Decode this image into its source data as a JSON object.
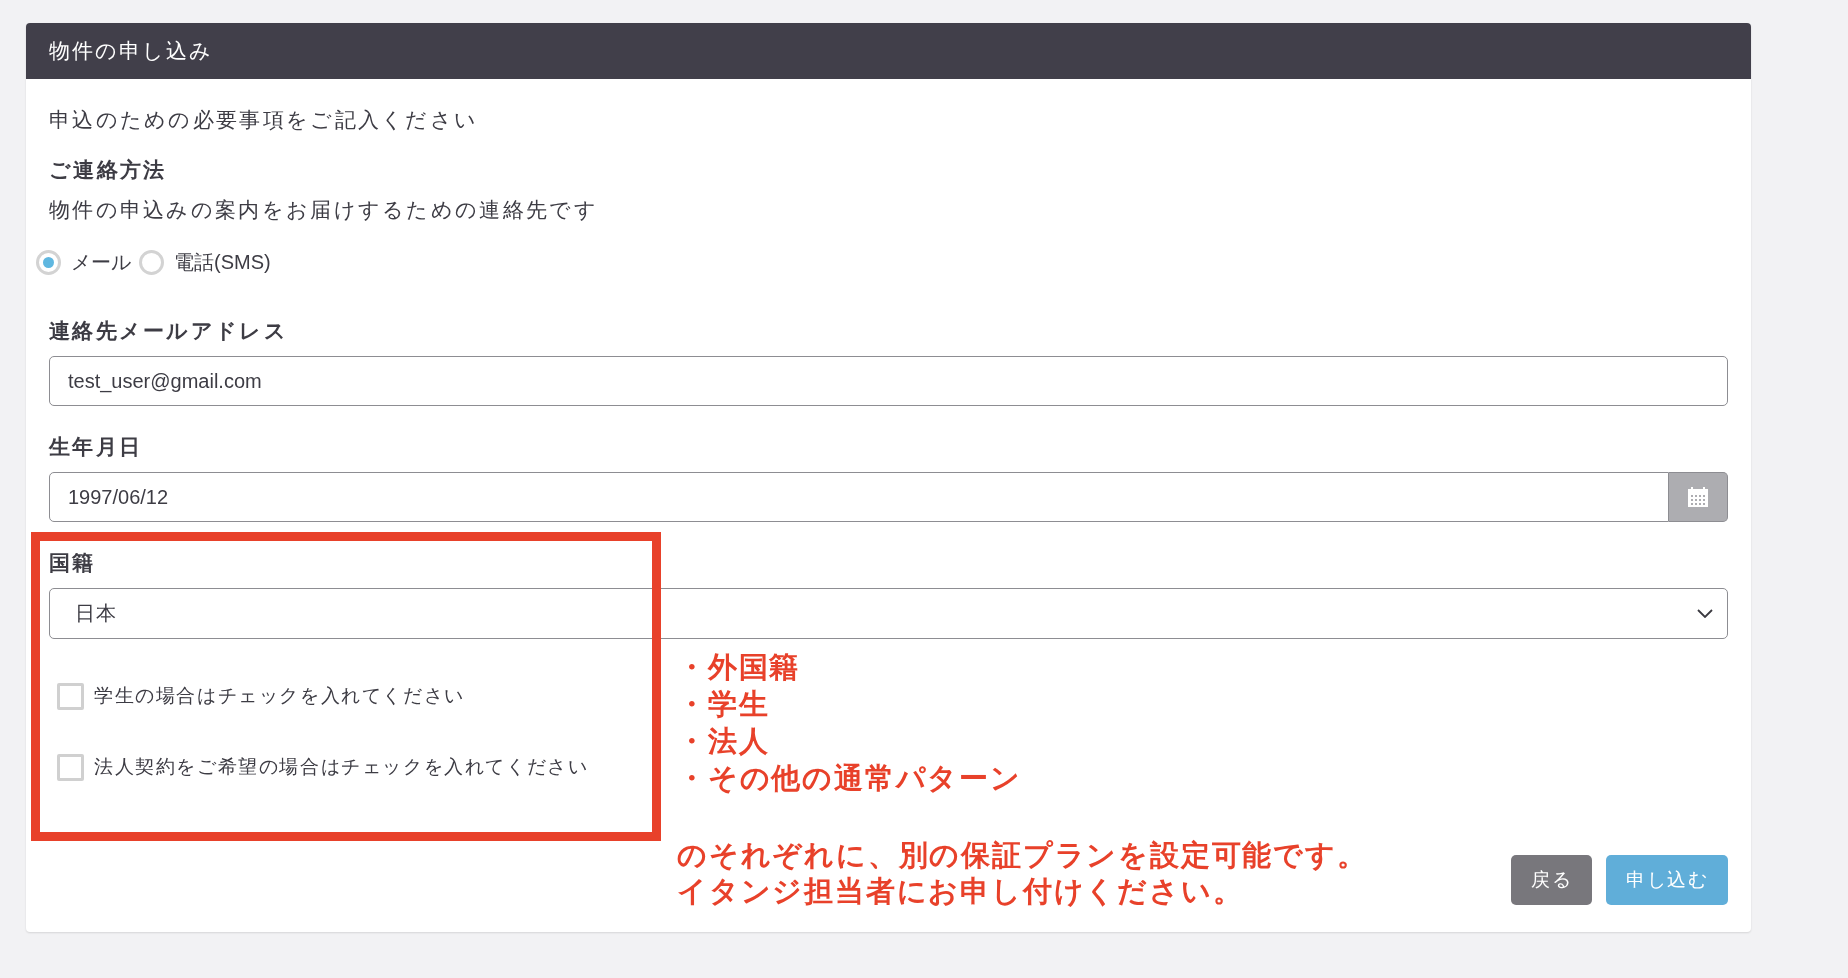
{
  "panel": {
    "title": "物件の申し込み"
  },
  "intro": "申込のための必要事項をご記入ください",
  "contact_method": {
    "heading": "ご連絡方法",
    "description": "物件の申込みの案内をお届けするための連絡先です",
    "options": [
      {
        "label": "メール",
        "selected": true
      },
      {
        "label": "電話(SMS)",
        "selected": false
      }
    ]
  },
  "fields": [
    {
      "kind": "text",
      "label": "連絡先メールアドレス",
      "value": "test_user@gmail.com"
    },
    {
      "kind": "date",
      "label": "生年月日",
      "value": "1997/06/12"
    },
    {
      "kind": "select",
      "label": "国籍",
      "value": "日本"
    }
  ],
  "checkboxes": [
    {
      "label": "学生の場合はチェックを入れてください",
      "checked": false
    },
    {
      "label": "法人契約をご希望の場合はチェックを入れてください",
      "checked": false
    }
  ],
  "annotation": {
    "items": [
      "・外国籍",
      "・学生",
      "・法人",
      "・その他の通常パターン"
    ],
    "note_lines": [
      "のそれぞれに、別の保証プランを設定可能です。",
      "イタンジ担当者にお申し付けください。"
    ]
  },
  "buttons": [
    {
      "kind": "secondary",
      "label": "戻る"
    },
    {
      "kind": "primary",
      "label": "申し込む"
    }
  ]
}
